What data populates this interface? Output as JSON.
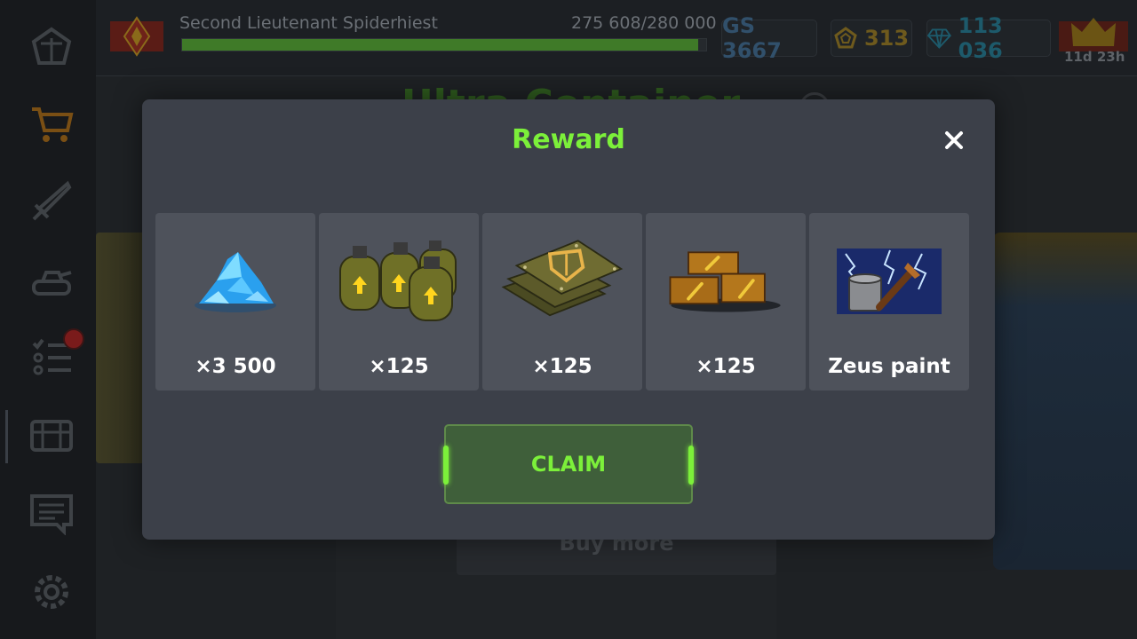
{
  "header": {
    "rank_name": "Second Lieutenant  Spiderhiest",
    "xp_text": "275 608/280 000",
    "xp_progress": 0.984,
    "gear_score": "GS 3667",
    "gold": "313",
    "gems": "113 036",
    "timer": "11d 23h"
  },
  "background": {
    "screen_title": "Ultra Container",
    "buy_more_label": "Buy more"
  },
  "sidebar": {
    "items": [
      {
        "icon": "home-icon"
      },
      {
        "icon": "shop-cart-icon"
      },
      {
        "icon": "sword-icon"
      },
      {
        "icon": "tank-icon"
      },
      {
        "icon": "missions-list-icon"
      },
      {
        "icon": "containers-icon"
      },
      {
        "icon": "news-icon"
      },
      {
        "icon": "settings-gear-icon"
      }
    ]
  },
  "modal": {
    "title": "Reward",
    "claim_label": "CLAIM",
    "rewards": [
      {
        "icon": "crystals-icon",
        "quantity": "×3 500"
      },
      {
        "icon": "gas-cylinders-icon",
        "quantity": "×125"
      },
      {
        "icon": "armor-plates-icon",
        "quantity": "×125"
      },
      {
        "icon": "repair-kit-crates-icon",
        "quantity": "×125"
      },
      {
        "icon": "zeus-paint-icon",
        "quantity": "Zeus paint"
      }
    ]
  },
  "colors": {
    "accent_green": "#7cf03a",
    "modal_bg": "#3c4049",
    "card_bg": "#4e525b"
  }
}
